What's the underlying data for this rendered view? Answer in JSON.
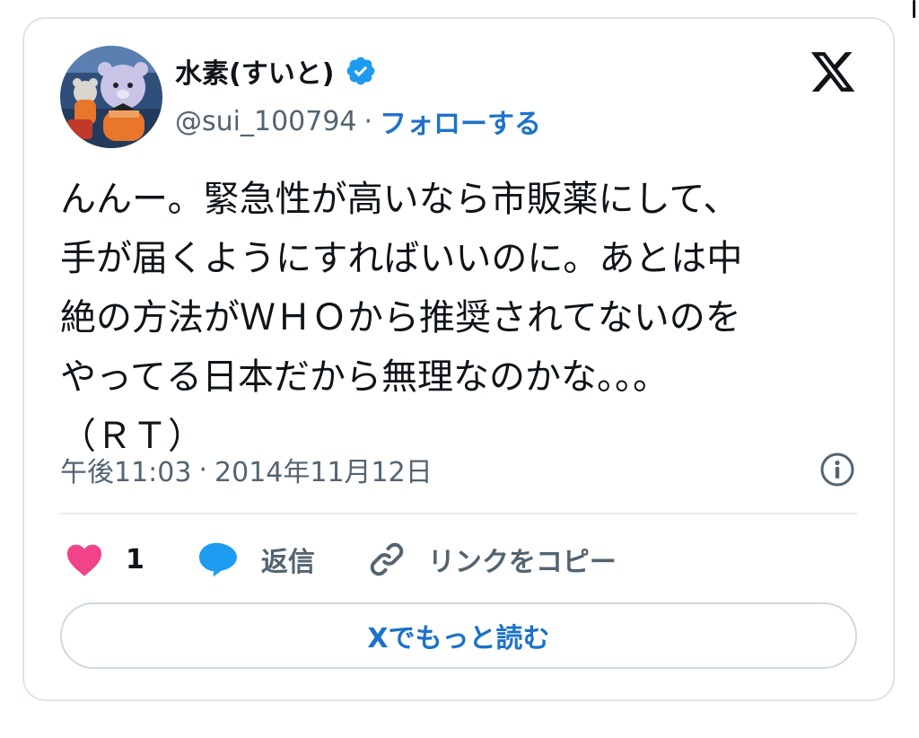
{
  "user": {
    "display_name": "水素(すいと)",
    "handle": "@sui_100794",
    "separator": "·",
    "follow_label": "フォローする",
    "verified": true
  },
  "tweet": {
    "lines": [
      "んんー。緊急性が高いなら市販薬にして、",
      "手が届くようにすればいいのに。あとは中",
      "絶の方法がＷＨＯから推奨されてないのを",
      "やってる日本だから無理なのかな。。。",
      "（ＲＴ）"
    ]
  },
  "meta": {
    "time": "午後11:03",
    "separator": "·",
    "date": "2014年11月12日"
  },
  "actions": {
    "like_count": "1",
    "reply_label": "返信",
    "copy_link_label": "リンクをコピー"
  },
  "read_more_label": "Xでもっと読む",
  "colors": {
    "accent": "#1d72c9",
    "like": "#f0438a",
    "reply": "#1d9bf0",
    "verified": "#1d9bf0",
    "text_primary": "#0f1419",
    "text_secondary": "#536471",
    "border": "#dfe3e7"
  },
  "icons": {
    "brand": "x-logo-icon",
    "verified": "verified-badge-icon",
    "info": "info-icon",
    "like": "heart-icon",
    "reply": "speech-bubble-icon",
    "copy": "link-icon"
  }
}
